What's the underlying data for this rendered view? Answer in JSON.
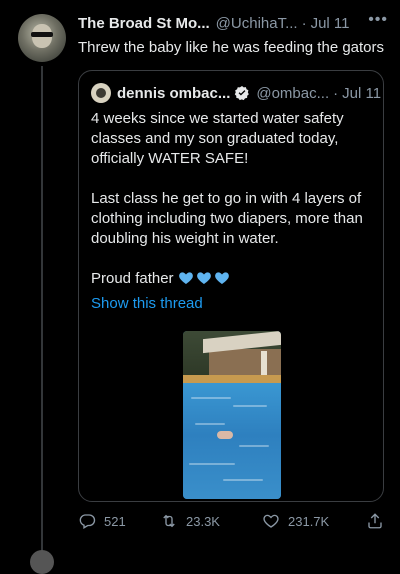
{
  "tweet": {
    "author_name": "The Broad St Mo...",
    "handle": "@UchihaT...",
    "separator": "·",
    "date": "Jul 11",
    "more": "•••",
    "text": "Threw the baby like he was feeding the gators"
  },
  "quote": {
    "author_name": "dennis ombac...",
    "handle": "@ombac...",
    "separator": "·",
    "date": "Jul 11",
    "paragraph1": "4 weeks since we started water safety classes and my son graduated today, officially WATER SAFE!",
    "paragraph2": "Last class he get to go in with 4 layers of clothing including two diapers, more than doubling his weight in water.",
    "paragraph3": "Proud father",
    "show_thread": "Show this thread"
  },
  "actions": {
    "replies": "521",
    "retweets": "23.3K",
    "likes": "231.7K"
  },
  "icons": [
    "reply-icon",
    "retweet-icon",
    "like-icon",
    "share-icon",
    "verified-icon",
    "blue-heart-icon"
  ],
  "colors": {
    "accent": "#1d9bf0",
    "heart": "#5fb4f0",
    "muted": "#8b98a5"
  }
}
